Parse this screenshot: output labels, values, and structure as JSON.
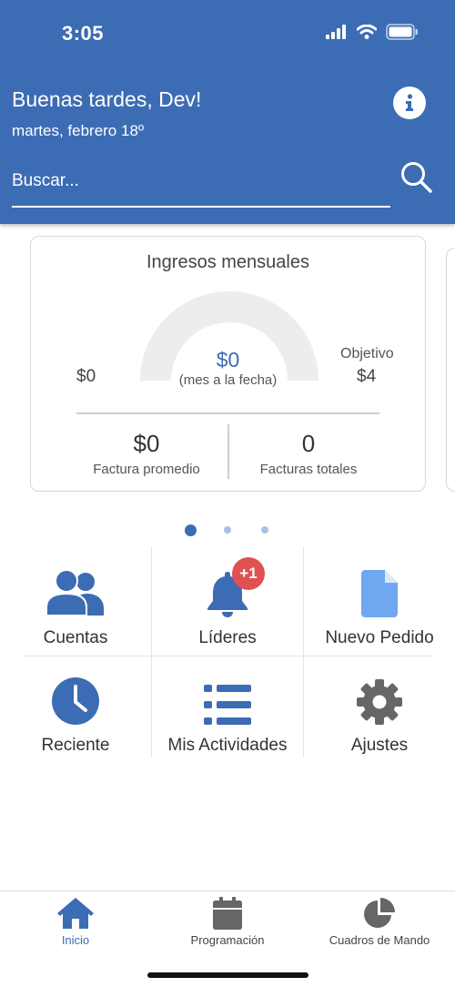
{
  "status_bar": {
    "time": "3:05"
  },
  "header": {
    "greeting": "Buenas tardes, Dev!",
    "date": "martes, febrero 18º",
    "search_placeholder": "Buscar..."
  },
  "card": {
    "title": "Ingresos mensuales",
    "gauge": {
      "value_label": "$0",
      "sub_label": "(mes a la fecha)",
      "min_label": "$0",
      "target_title": "Objetivo",
      "target_value": "$4",
      "progress": 0
    },
    "stats": [
      {
        "value": "$0",
        "label": "Factura promedio"
      },
      {
        "value": "0",
        "label": "Facturas totales"
      }
    ]
  },
  "pager": {
    "pages": 3,
    "active": 0
  },
  "tiles": [
    {
      "label": "Cuentas",
      "icon": "users-icon"
    },
    {
      "label": "Líderes",
      "icon": "bell-icon",
      "badge": "+1"
    },
    {
      "label": "Nuevo Pedido",
      "icon": "file-icon"
    },
    {
      "label": "Reciente",
      "icon": "clock-icon"
    },
    {
      "label": "Mis Actividades",
      "icon": "list-icon"
    },
    {
      "label": "Ajustes",
      "icon": "gear-icon"
    }
  ],
  "bottom_nav": [
    {
      "label": "Inicio",
      "icon": "home-icon",
      "active": true
    },
    {
      "label": "Programación",
      "icon": "calendar-icon",
      "active": false
    },
    {
      "label": "Cuadros de Mando",
      "icon": "pie-chart-icon",
      "active": false
    }
  ],
  "colors": {
    "primary": "#3c6cb4",
    "badge": "#e05252",
    "icon_gray": "#666666",
    "file_blue": "#6fa8f0"
  }
}
